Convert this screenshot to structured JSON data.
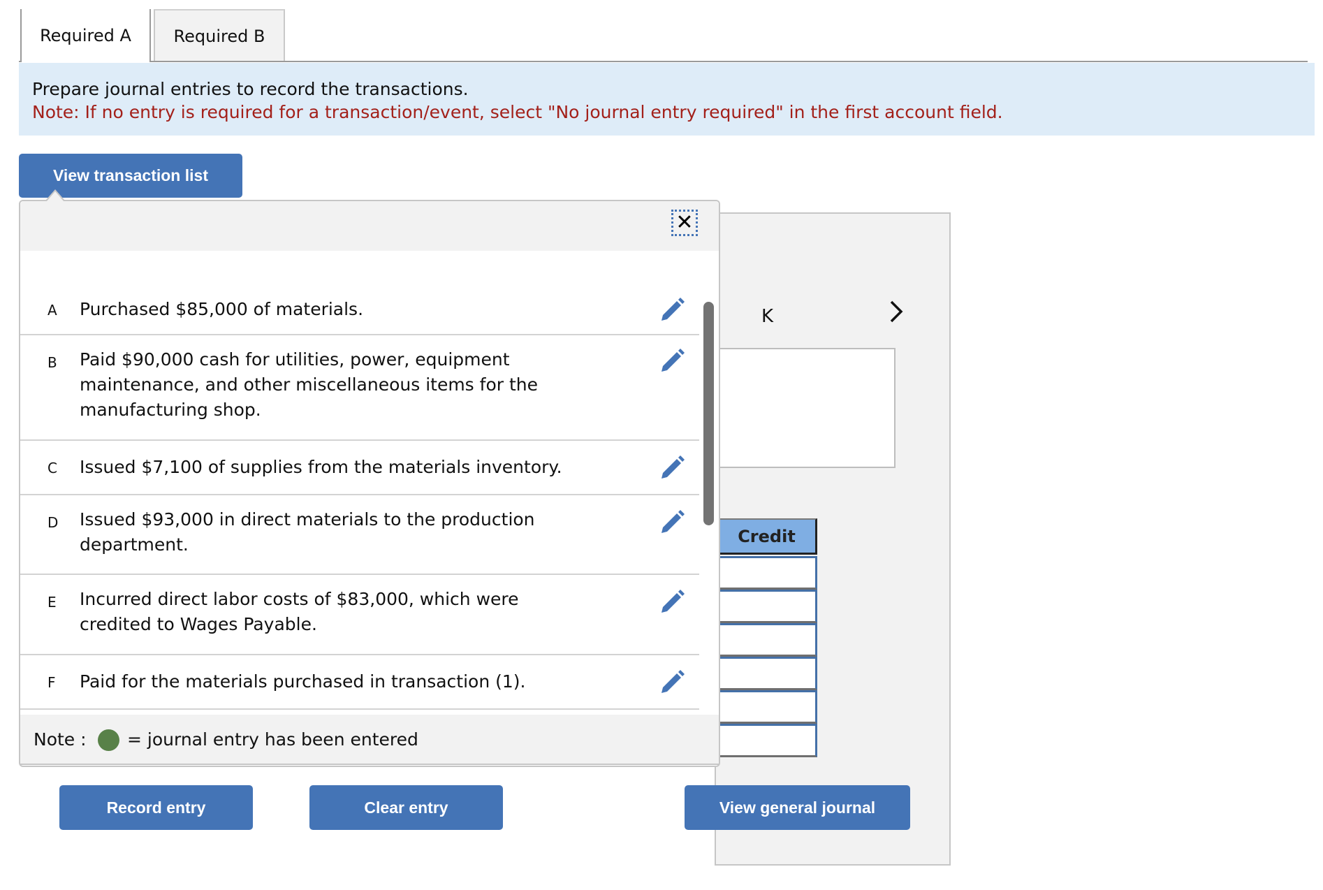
{
  "tabs": [
    {
      "label": "Required A",
      "active": true
    },
    {
      "label": "Required B",
      "active": false
    }
  ],
  "instructions": {
    "main": "Prepare journal entries to record the transactions.",
    "note": "Note: If no entry is required for a transaction/event, select \"No journal entry required\" in the first account field."
  },
  "transaction_list_button": {
    "label": "View transaction list"
  },
  "popup": {
    "close_icon": "close-icon",
    "transactions": [
      {
        "letter": "A",
        "text": "Purchased $85,000 of materials.",
        "icon": "pencil-icon",
        "entered": false
      },
      {
        "letter": "B",
        "text": "Paid $90,000 cash for utilities, power, equipment maintenance, and other miscellaneous items for the manufacturing shop.",
        "icon": "pencil-icon",
        "entered": false
      },
      {
        "letter": "C",
        "text": "Issued $7,100 of supplies from the materials inventory.",
        "icon": "pencil-icon",
        "entered": false
      },
      {
        "letter": "D",
        "text": "Issued $93,000 in direct materials to the production department.",
        "icon": "pencil-icon",
        "entered": false
      },
      {
        "letter": "E",
        "text": "Incurred direct labor costs of $83,000, which were credited to Wages Payable.",
        "icon": "pencil-icon",
        "entered": false
      },
      {
        "letter": "F",
        "text": "Paid for the materials purchased in transaction (1).",
        "icon": "pencil-icon",
        "entered": false
      }
    ],
    "note": {
      "label": "Note :",
      "legend_text": "= journal entry has been entered",
      "legend_color": "#588148"
    }
  },
  "journal_form": {
    "nav_letter": "K",
    "next_icon": "chevron-right-icon",
    "credit_header": "Credit",
    "credit_values": [
      "",
      "",
      "",
      "",
      "",
      ""
    ]
  },
  "buttons": {
    "record": "Record entry",
    "clear": "Clear entry",
    "view_general_journal": "View general journal"
  },
  "colors": {
    "accent_button": "#4474b6",
    "band_background": "#deecf8",
    "note_text": "#a3201a",
    "credit_header": "#7faee3"
  }
}
